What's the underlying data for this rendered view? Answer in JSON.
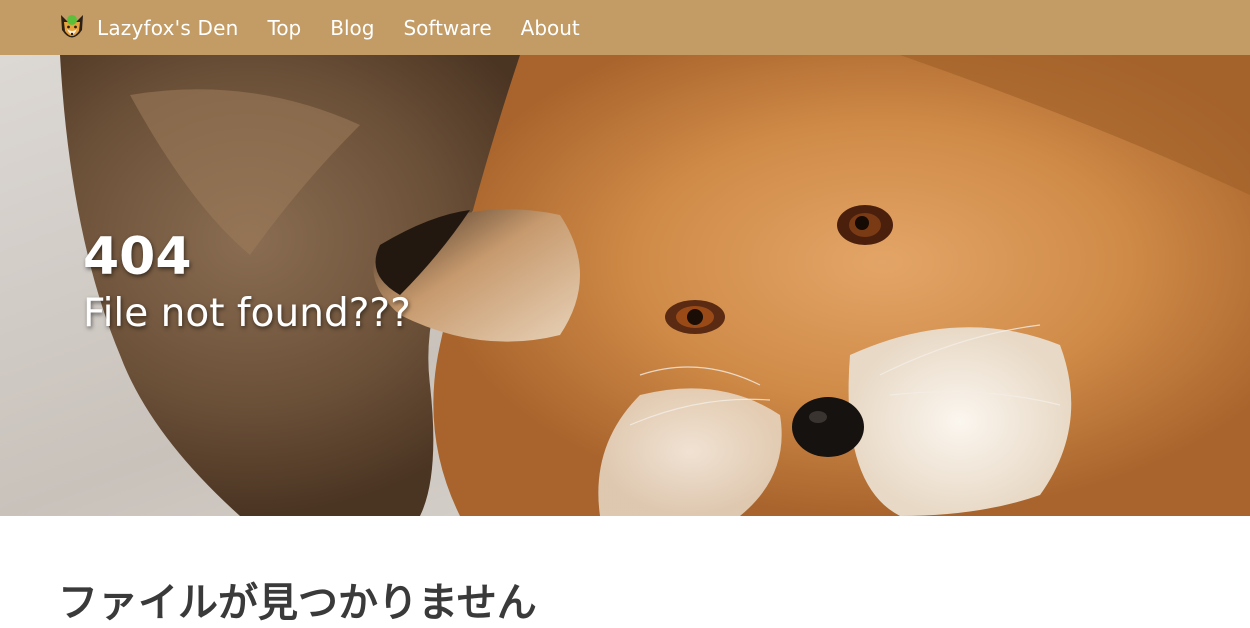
{
  "navbar": {
    "brand_text": "Lazyfox's Den",
    "brand_icon": "fox-face-icon",
    "background_color": "#c29b65",
    "links": [
      {
        "label": "Top"
      },
      {
        "label": "Blog"
      },
      {
        "label": "Software"
      },
      {
        "label": "About"
      }
    ]
  },
  "hero": {
    "title": "404",
    "subtitle": "File not found???",
    "background_image": "red-fox-photo"
  },
  "content": {
    "heading": "ファイルが見つかりません"
  }
}
